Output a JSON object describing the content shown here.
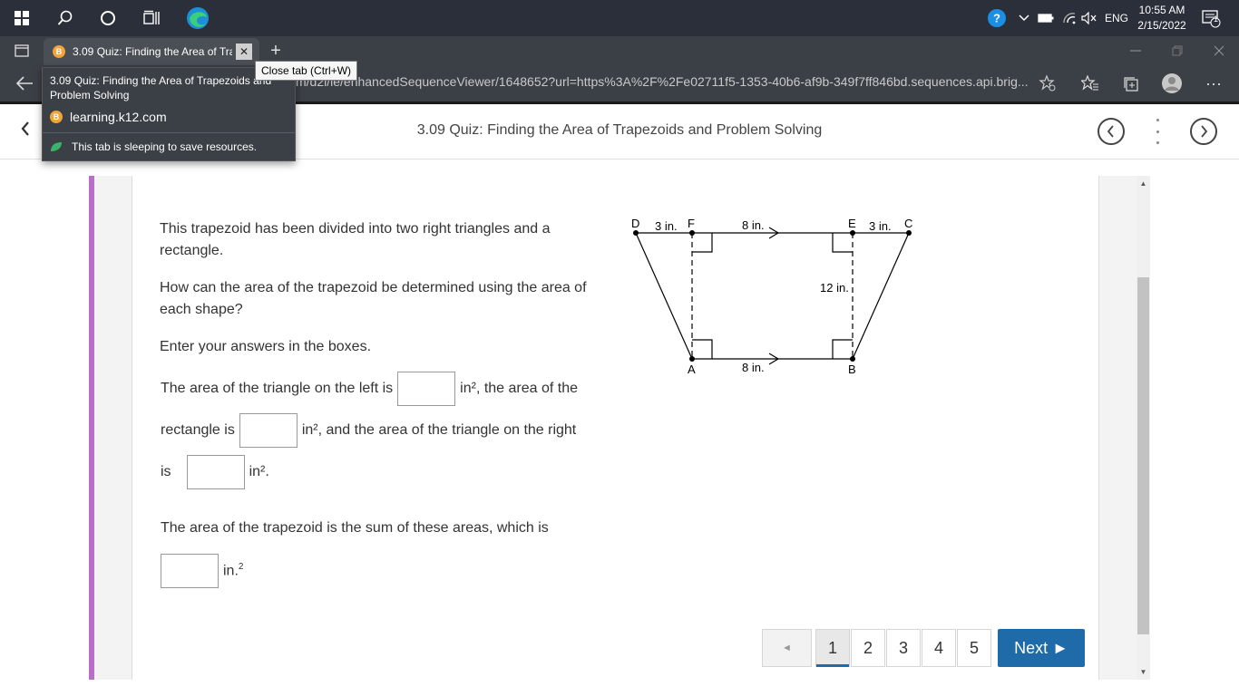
{
  "taskbar": {
    "icons": [
      "windows-start-icon",
      "search-icon",
      "cortana-icon",
      "task-view-icon",
      "edge-icon"
    ],
    "tray": {
      "language": "ENG",
      "time": "10:55 AM",
      "date": "2/15/2022",
      "notification_count": "1"
    }
  },
  "browser": {
    "tab": {
      "favicon": "B",
      "title": "3.09 Quiz: Finding the Area of Trapezoids and Problem Solving"
    },
    "new_tab": "+",
    "url": "m/d2l/le/enhancedSequenceViewer/1648652?url=https%3A%2F%2Fe02711f5-1353-40b6-af9b-349f7ff846bd.sequences.api.brig...",
    "tooltip_close": "Close tab (Ctrl+W)",
    "hovercard": {
      "title": "3.09 Quiz: Finding the Area of Trapezoids and Problem Solving",
      "domain": "learning.k12.com",
      "sleep_note": "This tab is sleeping to save resources."
    }
  },
  "lesson": {
    "title": "3.09 Quiz: Finding the Area of Trapezoids and Problem Solving"
  },
  "question": {
    "p1": "This trapezoid has been divided into two right triangles and a rectangle.",
    "p2": "How can the area of the trapezoid be determined using the area of each shape?",
    "p3": "Enter your answers in the boxes.",
    "line1_a": "The area of the triangle on the left is",
    "line1_b": "in², the area of the",
    "line2_a": "rectangle is",
    "line2_b": "in², and the area of the triangle on the right",
    "line3_a": "is",
    "line3_b": "in².",
    "line4": "The area of the trapezoid is the sum of these areas, which is",
    "line5_b": "in."
  },
  "diagram": {
    "labels": {
      "D": "D",
      "F": "F",
      "E": "E",
      "C": "C",
      "A": "A",
      "B": "B",
      "top_left": "3 in.",
      "top_mid": "8 in.",
      "top_right": "3 in.",
      "height": "12 in.",
      "bottom": "8 in."
    }
  },
  "pager": {
    "prev": "◄",
    "pages": [
      "1",
      "2",
      "3",
      "4",
      "5"
    ],
    "current": "1",
    "next": "Next ►"
  }
}
